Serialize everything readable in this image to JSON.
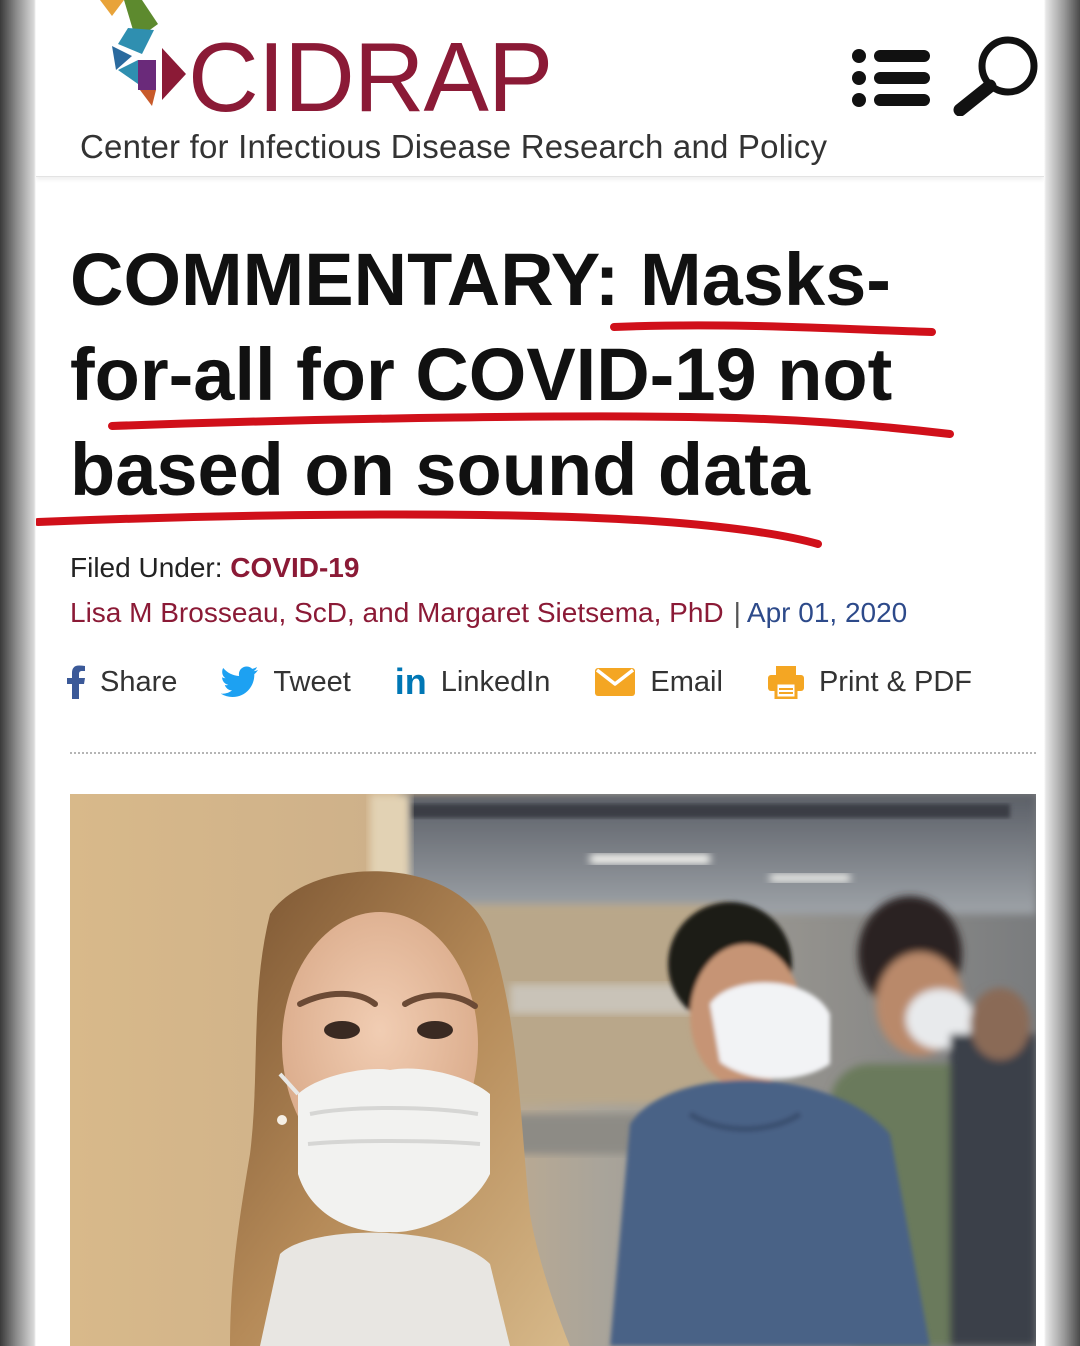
{
  "site": {
    "logo_text": "CIDRAP",
    "tagline": "Center for Infectious Disease Research and Policy",
    "brand_color": "#8b1a36",
    "link_color": "#2d4a8a",
    "menu_icon": "list-menu-icon",
    "search_icon": "magnifier-icon"
  },
  "article": {
    "headline": "COMMENTARY: Masks-for-all for COVID-19 not based on sound data",
    "filed_label": "Filed Under:",
    "filed_category": "COVID-19",
    "authors": "Lisa M Brosseau, ScD, and Margaret Sietsema, PhD",
    "byline_separator": "|",
    "date": "Apr 01, 2020",
    "annotation_color": "#d0101a"
  },
  "share": {
    "facebook": "Share",
    "twitter": "Tweet",
    "linkedin": "LinkedIn",
    "email": "Email",
    "print": "Print & PDF",
    "colors": {
      "facebook": "#3b5998",
      "twitter": "#1da1f2",
      "linkedin": "#0077b5",
      "email": "#f4a623",
      "print": "#f4a623"
    }
  }
}
